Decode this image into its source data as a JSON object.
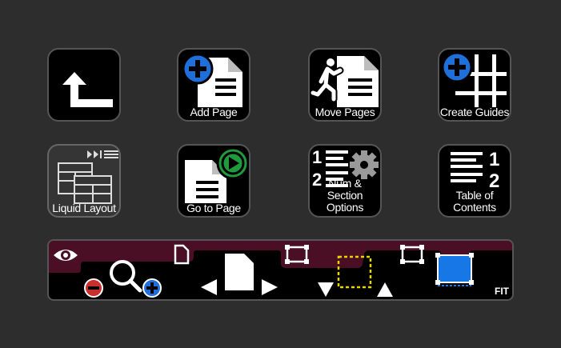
{
  "tiles": {
    "back": {
      "label": ""
    },
    "add_page": {
      "label": "Add Page"
    },
    "move_pages": {
      "label": "Move Pages"
    },
    "create_guides": {
      "label": "Create Guides"
    },
    "liquid_layout": {
      "label": "Liquid Layout"
    },
    "go_to_page": {
      "label": "Go to Page"
    },
    "num_section": {
      "label": "Num & Section Options"
    },
    "toc": {
      "label": "Table of Contents"
    }
  },
  "view_bar": {
    "fit_label": "FIT"
  },
  "icons": {
    "back": "return-arrow-icon",
    "add_page": "add-page-icon",
    "move_pages": "running-person-page-icon",
    "create_guides": "add-guides-icon",
    "liquid_layout": "liquid-layout-icon",
    "go_to_page": "go-to-page-icon",
    "num_section": "numbering-gear-icon",
    "toc": "table-of-contents-icon"
  },
  "colors": {
    "background": "#2d2d2d",
    "tile": "#000000",
    "accent_blue": "#1e6fd9",
    "accent_green": "#1f9a3c",
    "accent_red": "#c9302c",
    "bar_maroon": "#4a0f24",
    "guide_yellow": "#e8d400",
    "fit_blue": "#1877e6"
  }
}
